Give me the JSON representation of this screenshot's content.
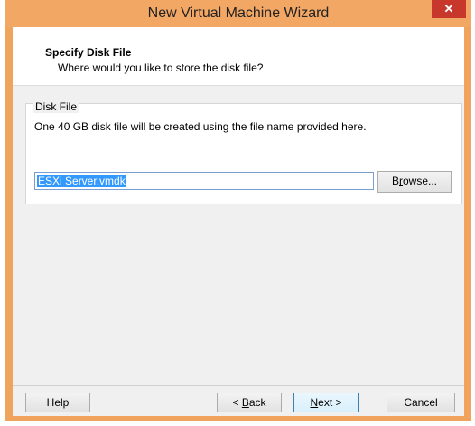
{
  "window": {
    "title": "New Virtual Machine Wizard",
    "close_glyph": "✕"
  },
  "header": {
    "title": "Specify Disk File",
    "subtitle": "Where would you like to store the disk file?"
  },
  "disk_file": {
    "group_label": "Disk File",
    "description": "One 40 GB disk file will be created using the file name provided here.",
    "file_name": "ESXi Server.vmdk"
  },
  "buttons": {
    "browse": {
      "pre": "B",
      "accel": "r",
      "post": "owse..."
    },
    "help": "Help",
    "back": {
      "pre": "< ",
      "accel": "B",
      "post": "ack"
    },
    "next": {
      "accel": "N",
      "post": "ext >"
    },
    "cancel": "Cancel"
  },
  "colors": {
    "titlebar": "#f3a765",
    "close": "#c7372c",
    "selection": "#3399ff"
  }
}
